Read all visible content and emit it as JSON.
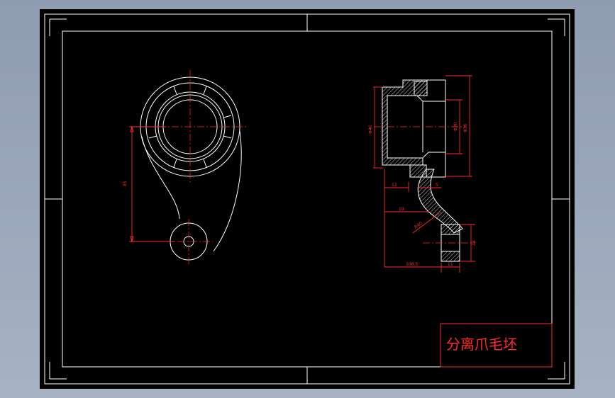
{
  "title_block": {
    "text": "分离爪毛坯"
  },
  "dimensions": {
    "front_vertical": "85",
    "bore_outer": "Φ46",
    "bore_inner": "Φ30",
    "bore_flange": "Φ36",
    "offset_12": "12",
    "offset_19": "19",
    "thickness_5": "5",
    "radius_r40": "R40",
    "boss_height": "28",
    "length_1085": "108.5",
    "boss_width": "11"
  },
  "colors": {
    "background": "#000000",
    "outline": "#ffffff",
    "dimension": "#ff2a2a"
  }
}
